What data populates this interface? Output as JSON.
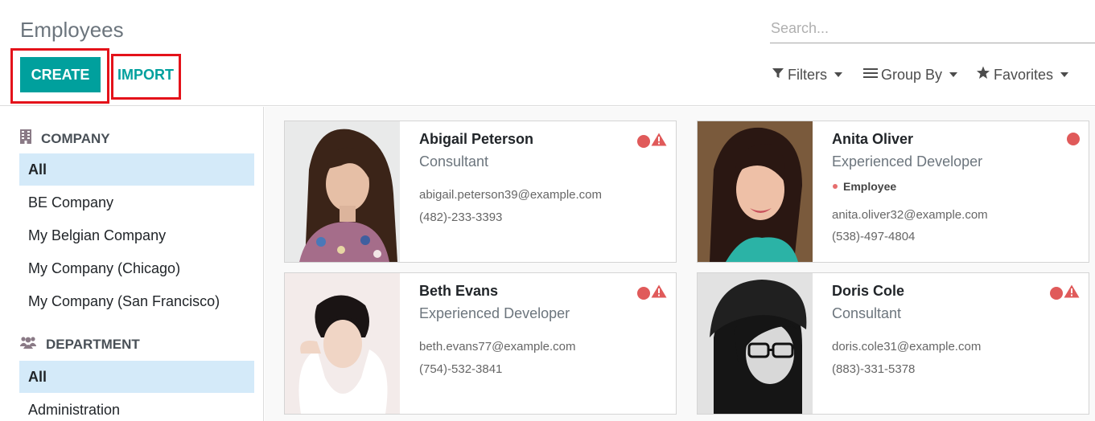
{
  "page": {
    "title": "Employees"
  },
  "search": {
    "placeholder": "Search..."
  },
  "buttons": {
    "create": "CREATE",
    "import": "IMPORT"
  },
  "search_options": {
    "filters": "Filters",
    "group_by": "Group By",
    "favorites": "Favorites"
  },
  "sidebar": {
    "company": {
      "header": "COMPANY",
      "icon": "building-icon",
      "items": [
        {
          "label": "All",
          "active": true
        },
        {
          "label": "BE Company",
          "active": false
        },
        {
          "label": "My Belgian Company",
          "active": false
        },
        {
          "label": "My Company (Chicago)",
          "active": false
        },
        {
          "label": "My Company (San Francisco)",
          "active": false
        }
      ]
    },
    "department": {
      "header": "DEPARTMENT",
      "icon": "users-icon",
      "items": [
        {
          "label": "All",
          "active": true
        },
        {
          "label": "Administration",
          "active": false
        }
      ]
    }
  },
  "employees": [
    {
      "name": "Abigail Peterson",
      "job": "Consultant",
      "tag": "",
      "email": "abigail.peterson39@example.com",
      "phone": "(482)-233-3393",
      "status": "absent-warning"
    },
    {
      "name": "Anita Oliver",
      "job": "Experienced Developer",
      "tag": "Employee",
      "email": "anita.oliver32@example.com",
      "phone": "(538)-497-4804",
      "status": "absent"
    },
    {
      "name": "Beth Evans",
      "job": "Experienced Developer",
      "tag": "",
      "email": "beth.evans77@example.com",
      "phone": "(754)-532-3841",
      "status": "absent-warning"
    },
    {
      "name": "Doris Cole",
      "job": "Consultant",
      "tag": "",
      "email": "doris.cole31@example.com",
      "phone": "(883)-331-5378",
      "status": "absent-warning"
    }
  ],
  "colors": {
    "primary": "#00a09d",
    "highlight": "#e4121a",
    "status_red": "#e05a5a",
    "active_bg": "#d4eaf9"
  }
}
